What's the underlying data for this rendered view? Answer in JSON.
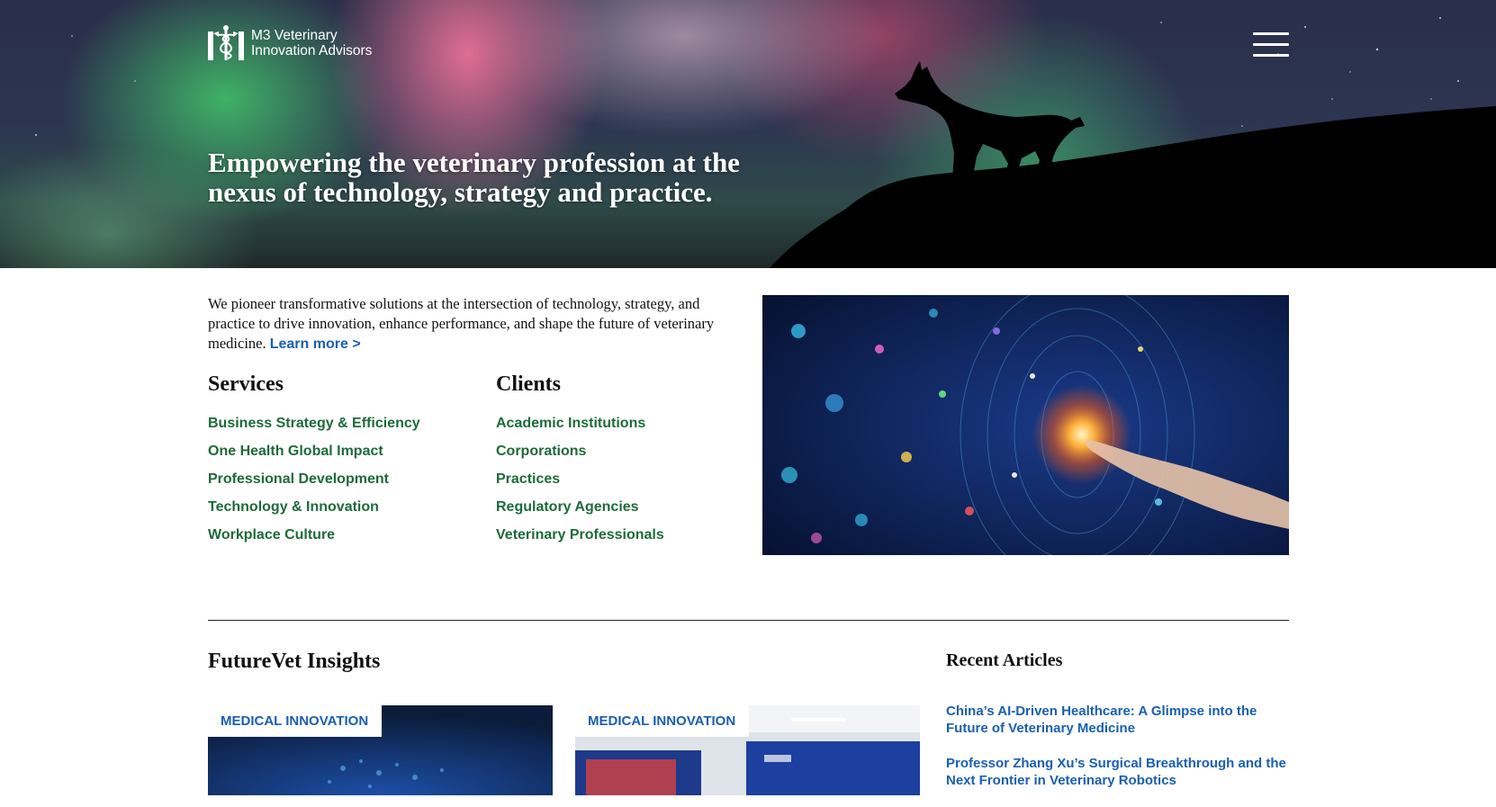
{
  "header": {
    "logo_line1": "M3 Veterinary",
    "logo_line2": "Innovation Advisors",
    "menu_icon": "hamburger-menu-icon"
  },
  "hero": {
    "headline_line1": "Empowering the veterinary profession at the",
    "headline_line2": "nexus of technology, strategy and practice."
  },
  "intro": {
    "text": "We pioneer transformative solutions at the intersection of technology, strategy, and practice to drive innovation, enhance performance, and shape the future of veterinary medicine.",
    "learn_more": "Learn more >"
  },
  "services": {
    "title": "Services",
    "items": [
      "Business Strategy & Efficiency",
      "One Health Global Impact",
      "Professional Development",
      "Technology & Innovation",
      "Workplace Culture"
    ]
  },
  "clients": {
    "title": "Clients",
    "items": [
      "Academic Institutions",
      "Corporations",
      "Practices",
      "Regulatory Agencies",
      "Veterinary Professionals"
    ]
  },
  "insights": {
    "title": "FutureVet Insights",
    "cards": [
      {
        "tag": "MEDICAL INNOVATION"
      },
      {
        "tag": "MEDICAL INNOVATION"
      }
    ]
  },
  "recent": {
    "title": "Recent Articles",
    "articles": [
      "China’s AI-Driven Healthcare: A Glimpse into the Future of Veterinary Medicine",
      "Professor Zhang Xu’s Surgical Breakthrough and the Next Frontier in Veterinary Robotics"
    ]
  },
  "colors": {
    "link_green": "#1d6b3a",
    "link_blue": "#1a5fb4",
    "text": "#111111"
  }
}
